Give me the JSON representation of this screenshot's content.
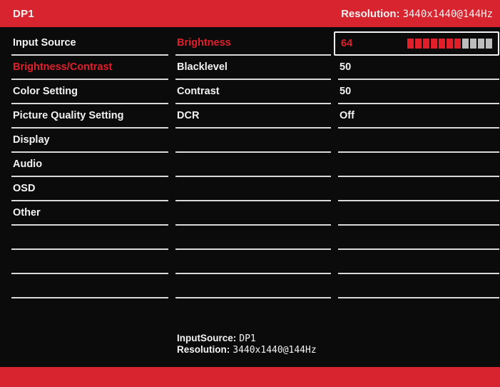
{
  "header": {
    "input": "DP1",
    "resolution_label": "Resolution:",
    "resolution_value": "3440x1440@144Hz"
  },
  "main_menu": [
    {
      "label": "Input Source",
      "active": false
    },
    {
      "label": "Brightness/Contrast",
      "active": true
    },
    {
      "label": "Color Setting",
      "active": false
    },
    {
      "label": "Picture Quality Setting",
      "active": false
    },
    {
      "label": "Display",
      "active": false
    },
    {
      "label": "Audio",
      "active": false
    },
    {
      "label": "OSD",
      "active": false
    },
    {
      "label": "Other",
      "active": false
    }
  ],
  "submenu": [
    {
      "label": "Brightness",
      "active": true
    },
    {
      "label": "Blacklevel",
      "active": false
    },
    {
      "label": "Contrast",
      "active": false
    },
    {
      "label": "DCR",
      "active": false
    }
  ],
  "values": [
    {
      "value": "64",
      "selected": true
    },
    {
      "value": "50",
      "selected": false
    },
    {
      "value": "50",
      "selected": false
    },
    {
      "value": "Off",
      "selected": false
    }
  ],
  "brightness_level": 64,
  "brightness_segments": {
    "total": 11,
    "filled": 7
  },
  "footer": {
    "input_label": "InputSource:",
    "input_value": "DP1",
    "resolution_label": "Resolution:",
    "resolution_value": "3440x1440@144Hz"
  },
  "colors": {
    "accent": "#d8242f",
    "active_text": "#e11f2b",
    "background": "#0b0b0c"
  }
}
